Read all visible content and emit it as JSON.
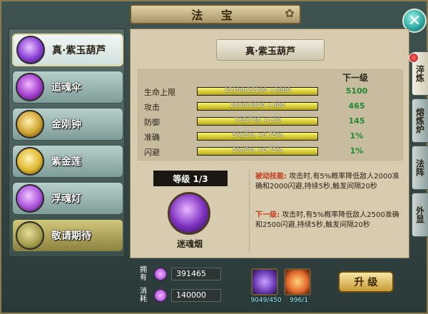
{
  "title": "法 宝",
  "close_icon_glyph": "✕",
  "sidebar": {
    "items": [
      {
        "label": "真·紫玉葫芦",
        "color": "#a24fe6",
        "active": true
      },
      {
        "label": "追魂伞",
        "color": "#b04ad0"
      },
      {
        "label": "金刚钟",
        "color": "#d8b13a"
      },
      {
        "label": "紫金莲",
        "color": "#e2c035"
      },
      {
        "label": "浮魂灯",
        "color": "#b55de0"
      },
      {
        "label": "敬请期待",
        "color": "#c9c06a",
        "locked": true
      }
    ]
  },
  "main": {
    "treasure_name": "真·紫玉葫芦",
    "next_level_label": "下一级",
    "stats": [
      {
        "label": "生命上限",
        "bar_text": "25100/25100 +2880",
        "fill": 1.0,
        "next": "5100"
      },
      {
        "label": "攻击",
        "bar_text": "2820/2820 +300",
        "fill": 1.0,
        "next": "465"
      },
      {
        "label": "防御",
        "bar_text": "735/735 +110",
        "fill": 1.0,
        "next": "145"
      },
      {
        "label": "准确",
        "bar_text": "5%/5% +0.75%",
        "fill": 1.0,
        "next": "1%"
      },
      {
        "label": "闪避",
        "bar_text": "5%/5% +0.75%",
        "fill": 1.0,
        "next": "1%"
      }
    ],
    "level_title": "等级 1/3",
    "level_item_name": "迷魂烟",
    "skill": {
      "key_label": "被动技能:",
      "desc": "攻击时,有5%概率降低敌人2000准确和2000闪避,持续5秒,触发间隔20秒",
      "next_label": "下一级:",
      "next_desc": "攻击时,有5%概率降低敌人2500准确和2500闪避,持续5秒,触发间隔20秒"
    }
  },
  "right_tabs": [
    {
      "label": "淬炼",
      "active": true
    },
    {
      "label": "熔炼炉"
    },
    {
      "label": "法阵"
    },
    {
      "label": "外显"
    }
  ],
  "resources": {
    "owned_label": "拥有",
    "owned_value": "391465",
    "cost_label": "消耗",
    "cost_value": "140000"
  },
  "materials": [
    {
      "icon": "purple-crystal-icon",
      "color": "#8a55e6",
      "count": "9049/450"
    },
    {
      "icon": "fire-talisman-icon",
      "color": "#e8713a",
      "count": "996/1"
    }
  ],
  "upgrade_label": "升 级"
}
